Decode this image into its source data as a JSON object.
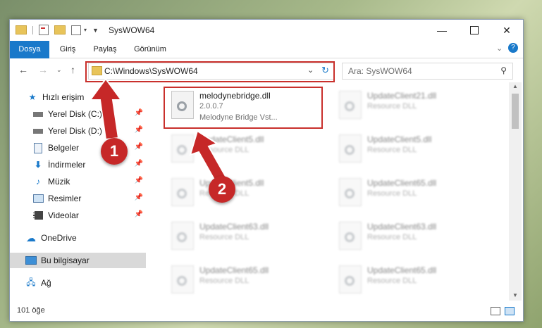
{
  "window": {
    "title": "SysWOW64"
  },
  "ribbon": {
    "tabs": [
      "Dosya",
      "Giriş",
      "Paylaş",
      "Görünüm"
    ]
  },
  "address": {
    "path": "C:\\Windows\\SysWOW64"
  },
  "search": {
    "placeholder": "Ara: SysWOW64"
  },
  "sidebar": {
    "items": [
      {
        "label": "Hızlı erişim",
        "icon": "star-icon",
        "pinned": false
      },
      {
        "label": "Yerel Disk (C:)",
        "icon": "drive-icon",
        "pinned": true
      },
      {
        "label": "Yerel Disk (D:)",
        "icon": "drive-icon",
        "pinned": true
      },
      {
        "label": "Belgeler",
        "icon": "document-icon",
        "pinned": true
      },
      {
        "label": "İndirmeler",
        "icon": "download-icon",
        "pinned": true
      },
      {
        "label": "Müzik",
        "icon": "music-icon",
        "pinned": true
      },
      {
        "label": "Resimler",
        "icon": "pictures-icon",
        "pinned": true
      },
      {
        "label": "Videolar",
        "icon": "video-icon",
        "pinned": true
      },
      {
        "label": "OneDrive",
        "icon": "cloud-icon",
        "pinned": false
      },
      {
        "label": "Bu bilgisayar",
        "icon": "computer-icon",
        "pinned": false,
        "selected": true
      },
      {
        "label": "Ağ",
        "icon": "network-icon",
        "pinned": false
      }
    ]
  },
  "files": {
    "highlighted": {
      "name": "melodynebridge.dll",
      "version": "2.0.0.7",
      "description": "Melodyne Bridge Vst..."
    },
    "left_column": [
      {
        "name": "UpdateClient5.dll",
        "type": "Resource DLL"
      },
      {
        "name": "UpdateClient5.dll",
        "type": "Resource DLL"
      },
      {
        "name": "UpdateClient63.dll",
        "type": "Resource DLL"
      },
      {
        "name": "UpdateClient65.dll",
        "type": "Resource DLL"
      }
    ],
    "right_column": [
      {
        "name": "UpdateClient21.dll",
        "type": "Resource DLL"
      },
      {
        "name": "UpdateClient5.dll",
        "type": "Resource DLL"
      },
      {
        "name": "UpdateClient65.dll",
        "type": "Resource DLL"
      },
      {
        "name": "UpdateClient63.dll",
        "type": "Resource DLL"
      },
      {
        "name": "UpdateClient65.dll",
        "type": "Resource DLL"
      }
    ]
  },
  "status": {
    "count": "101 öğe"
  },
  "annotations": {
    "badge1": "1",
    "badge2": "2",
    "color": "#c62828"
  }
}
